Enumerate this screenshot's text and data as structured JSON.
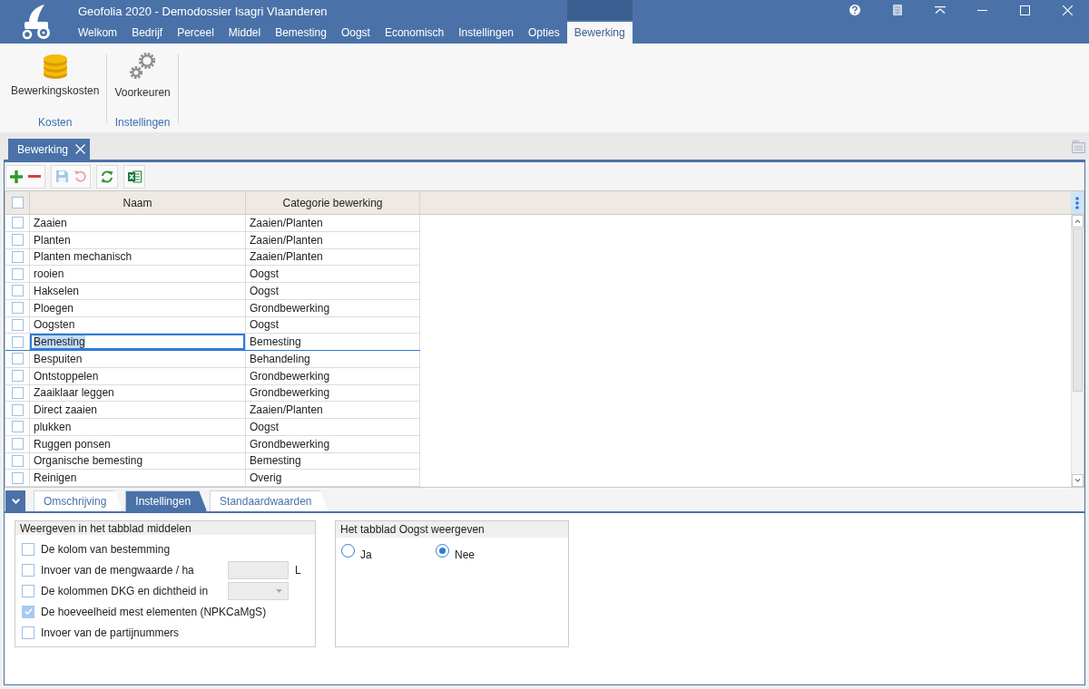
{
  "window": {
    "title": "Geofolia 2020 - Demodossier Isagri Vlaanderen"
  },
  "menu": [
    {
      "label": "Welkom",
      "selected": false
    },
    {
      "label": "Bedrijf",
      "selected": false
    },
    {
      "label": "Perceel",
      "selected": false
    },
    {
      "label": "Middel",
      "selected": false
    },
    {
      "label": "Bemesting",
      "selected": false
    },
    {
      "label": "Oogst",
      "selected": false
    },
    {
      "label": "Economisch",
      "selected": false
    },
    {
      "label": "Instellingen",
      "selected": false
    },
    {
      "label": "Opties",
      "selected": false
    },
    {
      "label": "Bewerking",
      "selected": true
    }
  ],
  "ribbon": {
    "groups": [
      {
        "label": "Kosten",
        "buttons": [
          {
            "label": "Bewerkingskosten",
            "kind": "coins"
          }
        ]
      },
      {
        "label": "Instellingen",
        "buttons": [
          {
            "label": "Voorkeuren",
            "kind": "gears"
          }
        ]
      }
    ]
  },
  "document_tabs": [
    {
      "label": "Bewerking",
      "selected": true
    }
  ],
  "toolbar": {
    "groups": [
      {
        "buttons": [
          {
            "kind": "add",
            "disabled": false
          },
          {
            "kind": "remove",
            "disabled": false
          }
        ]
      },
      {
        "buttons": [
          {
            "kind": "save",
            "disabled": true
          },
          {
            "kind": "undo",
            "disabled": true
          }
        ]
      },
      {
        "buttons": [
          {
            "kind": "refresh",
            "disabled": false
          }
        ]
      },
      {
        "buttons": [
          {
            "kind": "excel",
            "disabled": false
          }
        ]
      }
    ]
  },
  "table": {
    "header_checked": false,
    "columns": [
      "Naam",
      "Categorie bewerking"
    ],
    "rows": [
      {
        "checked": false,
        "selected": false,
        "cells": [
          "Zaaien",
          "Zaaien/Planten"
        ]
      },
      {
        "checked": false,
        "selected": false,
        "cells": [
          "Planten",
          "Zaaien/Planten"
        ]
      },
      {
        "checked": false,
        "selected": false,
        "cells": [
          "Planten mechanisch",
          "Zaaien/Planten"
        ]
      },
      {
        "checked": false,
        "selected": false,
        "cells": [
          "rooien",
          "Oogst"
        ]
      },
      {
        "checked": false,
        "selected": false,
        "cells": [
          "Hakselen",
          "Oogst"
        ]
      },
      {
        "checked": false,
        "selected": false,
        "cells": [
          "Ploegen",
          "Grondbewerking"
        ]
      },
      {
        "checked": false,
        "selected": false,
        "cells": [
          "Oogsten",
          "Oogst"
        ]
      },
      {
        "checked": false,
        "selected": true,
        "cells": [
          "Bemesting",
          "Bemesting"
        ]
      },
      {
        "checked": false,
        "selected": false,
        "cells": [
          "Bespuiten",
          "Behandeling"
        ]
      },
      {
        "checked": false,
        "selected": false,
        "cells": [
          "Ontstoppelen",
          "Grondbewerking"
        ]
      },
      {
        "checked": false,
        "selected": false,
        "cells": [
          "Zaaiklaar leggen",
          "Grondbewerking"
        ]
      },
      {
        "checked": false,
        "selected": false,
        "cells": [
          "Direct zaaien",
          "Zaaien/Planten"
        ]
      },
      {
        "checked": false,
        "selected": false,
        "cells": [
          "plukken",
          "Oogst"
        ]
      },
      {
        "checked": false,
        "selected": false,
        "cells": [
          "Ruggen ponsen",
          "Grondbewerking"
        ]
      },
      {
        "checked": false,
        "selected": false,
        "cells": [
          "Organische bemesting",
          "Bemesting"
        ]
      },
      {
        "checked": false,
        "selected": false,
        "cells": [
          "Reinigen",
          "Overig"
        ]
      }
    ]
  },
  "detail_panel": {
    "tabs": [
      {
        "label": "Omschrijving",
        "selected": false
      },
      {
        "label": "Instellingen",
        "selected": true
      },
      {
        "label": "Standaardwaarden",
        "selected": false
      }
    ],
    "display_group": {
      "title": "Weergeven in het tabblad middelen",
      "options": [
        {
          "label": "De kolom van bestemming",
          "checked": false
        },
        {
          "label": "Invoer van de mengwaarde / ha",
          "checked": false,
          "field": {
            "kind": "input",
            "disabled": true
          },
          "unit": "L"
        },
        {
          "label": "De kolommen DKG en dichtheid in",
          "checked": false,
          "field": {
            "kind": "dropdown",
            "disabled": true
          }
        },
        {
          "label": "De hoeveelheid mest elementen (NPKCaMgS)",
          "checked": true
        },
        {
          "label": "Invoer van de partijnummers",
          "checked": false
        }
      ]
    },
    "harvest_group": {
      "title": "Het tabblad Oogst weergeven",
      "options": [
        {
          "label": "Ja",
          "selected": false
        },
        {
          "label": "Nee",
          "selected": true
        }
      ]
    }
  }
}
